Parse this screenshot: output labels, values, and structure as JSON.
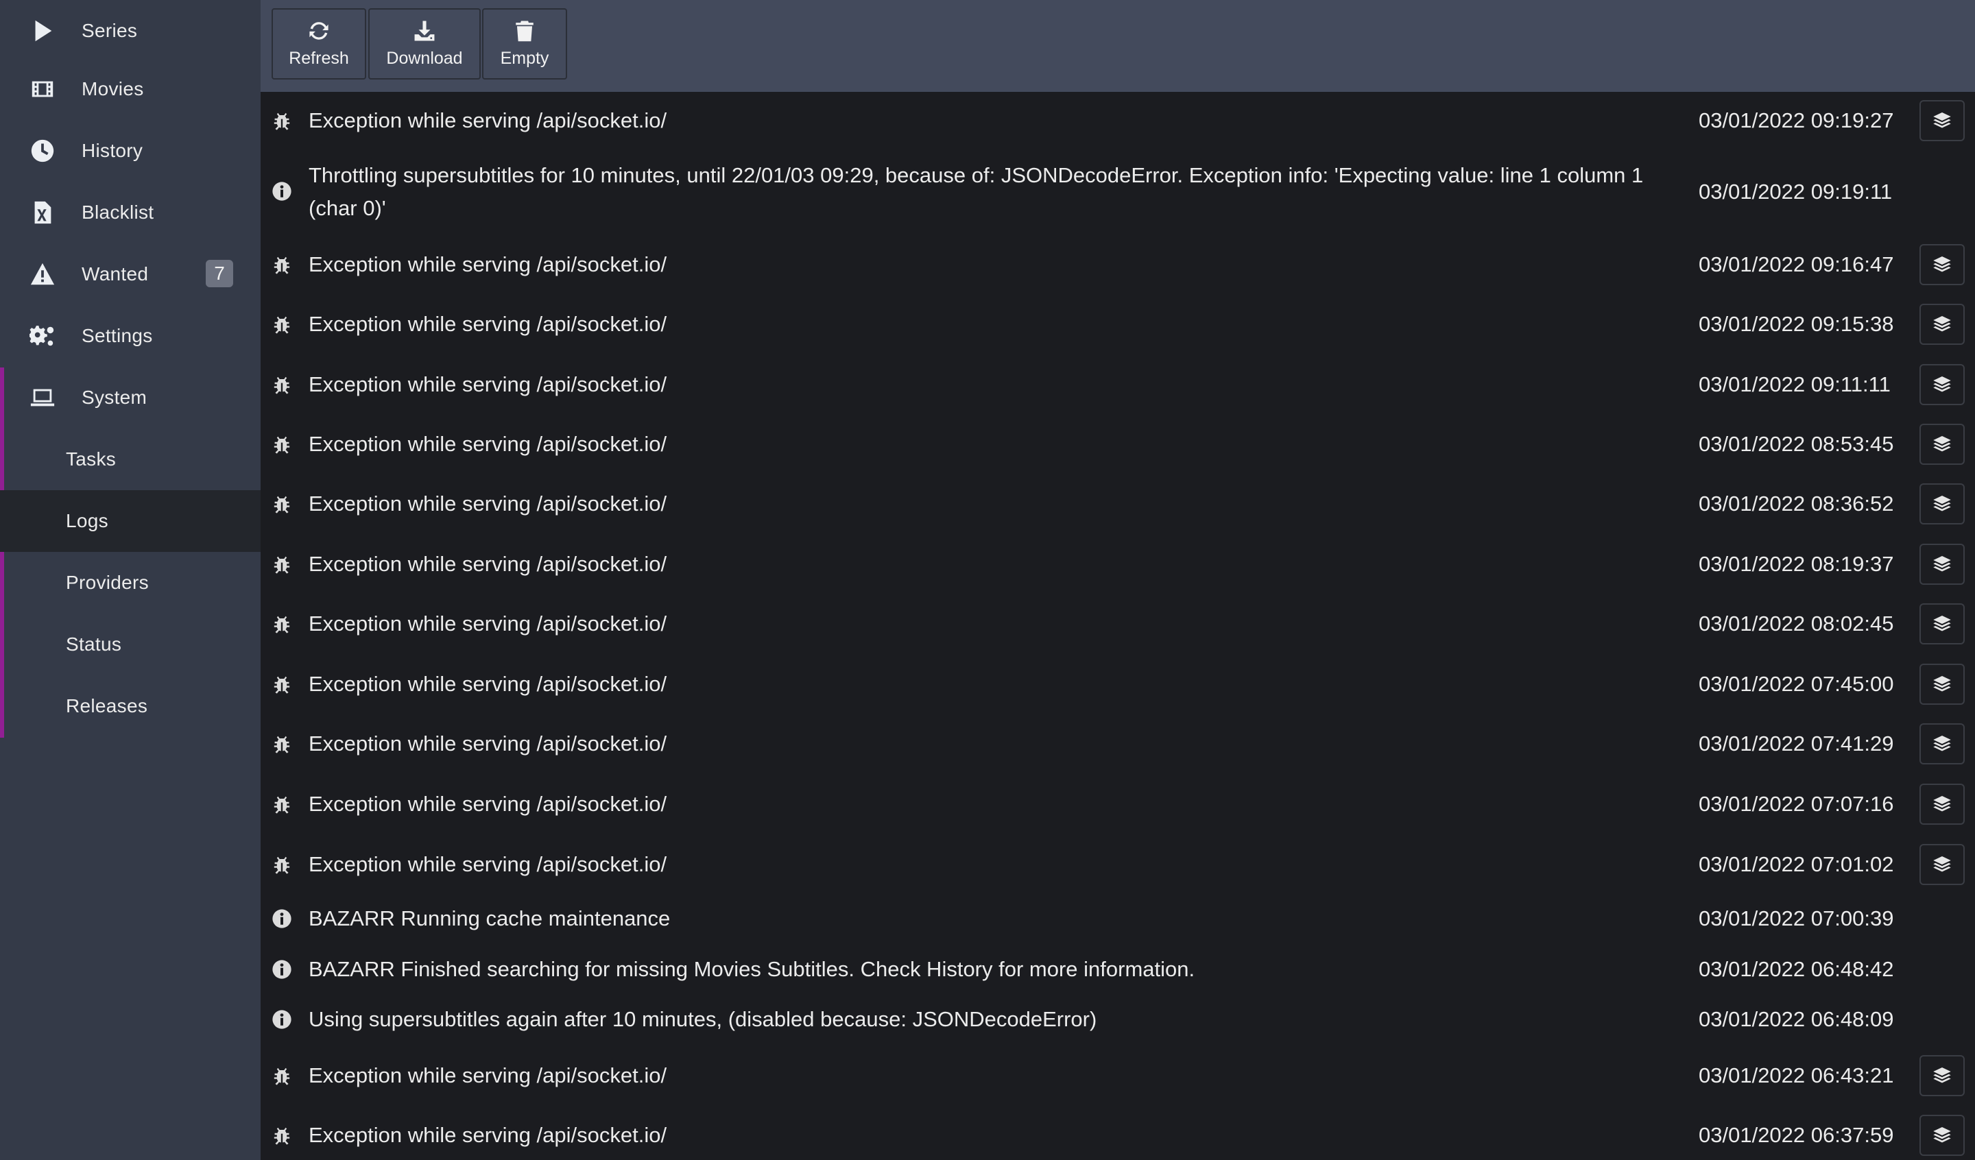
{
  "sidebar": {
    "items": [
      {
        "label": "Series",
        "icon": "play-icon"
      },
      {
        "label": "Movies",
        "icon": "film-icon"
      },
      {
        "label": "History",
        "icon": "clock-icon"
      },
      {
        "label": "Blacklist",
        "icon": "file-excel-icon"
      },
      {
        "label": "Wanted",
        "icon": "warning-icon",
        "badge": "7"
      },
      {
        "label": "Settings",
        "icon": "gears-icon"
      },
      {
        "label": "System",
        "icon": "laptop-icon"
      }
    ],
    "system_sub": [
      {
        "label": "Tasks"
      },
      {
        "label": "Logs",
        "active": true
      },
      {
        "label": "Providers"
      },
      {
        "label": "Status"
      },
      {
        "label": "Releases"
      }
    ]
  },
  "toolbar": {
    "refresh_label": "Refresh",
    "download_label": "Download",
    "empty_label": "Empty"
  },
  "logs": [
    {
      "type": "bug",
      "message": "Exception while serving /api/socket.io/",
      "time": "03/01/2022 09:19:27",
      "has_detail": true
    },
    {
      "type": "info",
      "message": "Throttling supersubtitles for 10 minutes, until 22/01/03 09:29, because of: JSONDecodeError. Exception info: 'Expecting value: line 1 column 1 (char 0)'",
      "time": "03/01/2022 09:19:11",
      "has_detail": false
    },
    {
      "type": "bug",
      "message": "Exception while serving /api/socket.io/",
      "time": "03/01/2022 09:16:47",
      "has_detail": true
    },
    {
      "type": "bug",
      "message": "Exception while serving /api/socket.io/",
      "time": "03/01/2022 09:15:38",
      "has_detail": true
    },
    {
      "type": "bug",
      "message": "Exception while serving /api/socket.io/",
      "time": "03/01/2022 09:11:11",
      "has_detail": true
    },
    {
      "type": "bug",
      "message": "Exception while serving /api/socket.io/",
      "time": "03/01/2022 08:53:45",
      "has_detail": true
    },
    {
      "type": "bug",
      "message": "Exception while serving /api/socket.io/",
      "time": "03/01/2022 08:36:52",
      "has_detail": true
    },
    {
      "type": "bug",
      "message": "Exception while serving /api/socket.io/",
      "time": "03/01/2022 08:19:37",
      "has_detail": true
    },
    {
      "type": "bug",
      "message": "Exception while serving /api/socket.io/",
      "time": "03/01/2022 08:02:45",
      "has_detail": true
    },
    {
      "type": "bug",
      "message": "Exception while serving /api/socket.io/",
      "time": "03/01/2022 07:45:00",
      "has_detail": true
    },
    {
      "type": "bug",
      "message": "Exception while serving /api/socket.io/",
      "time": "03/01/2022 07:41:29",
      "has_detail": true
    },
    {
      "type": "bug",
      "message": "Exception while serving /api/socket.io/",
      "time": "03/01/2022 07:07:16",
      "has_detail": true
    },
    {
      "type": "bug",
      "message": "Exception while serving /api/socket.io/",
      "time": "03/01/2022 07:01:02",
      "has_detail": true
    },
    {
      "type": "info",
      "message": "BAZARR Running cache maintenance",
      "time": "03/01/2022 07:00:39",
      "has_detail": false
    },
    {
      "type": "info",
      "message": "BAZARR Finished searching for missing Movies Subtitles. Check History for more information.",
      "time": "03/01/2022 06:48:42",
      "has_detail": false
    },
    {
      "type": "info",
      "message": "Using supersubtitles again after 10 minutes, (disabled because: JSONDecodeError)",
      "time": "03/01/2022 06:48:09",
      "has_detail": false
    },
    {
      "type": "bug",
      "message": "Exception while serving /api/socket.io/",
      "time": "03/01/2022 06:43:21",
      "has_detail": true
    },
    {
      "type": "bug",
      "message": "Exception while serving /api/socket.io/",
      "time": "03/01/2022 06:37:59",
      "has_detail": true
    }
  ]
}
